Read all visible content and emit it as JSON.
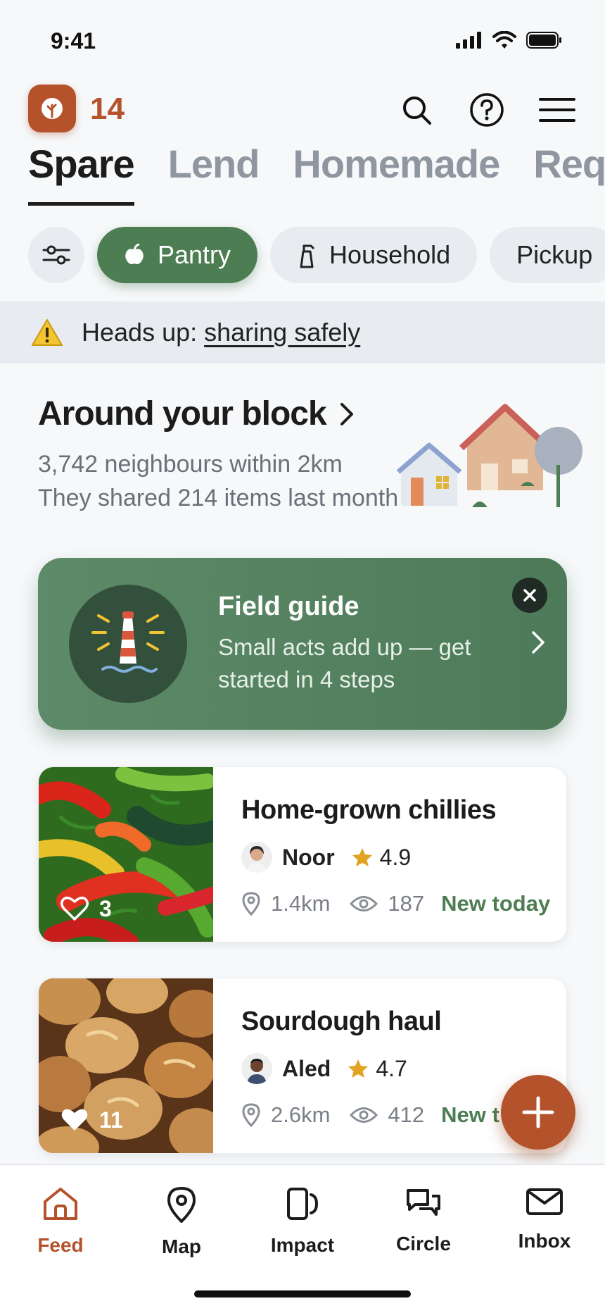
{
  "status": {
    "time": "9:41"
  },
  "header": {
    "badge_count": "14"
  },
  "tabs": [
    {
      "label": "Spare",
      "active": true
    },
    {
      "label": "Lend",
      "active": false
    },
    {
      "label": "Homemade",
      "active": false
    },
    {
      "label": "Req",
      "active": false
    }
  ],
  "chips": [
    {
      "label": "Pantry",
      "icon": "apple-icon",
      "active": true
    },
    {
      "label": "Household",
      "icon": "spray-bottle-icon",
      "active": false
    },
    {
      "label": "Pickup",
      "icon": "",
      "active": false
    }
  ],
  "banner": {
    "prefix": "Heads up:",
    "link": "sharing safely"
  },
  "around": {
    "title": "Around your block",
    "neighbours": "3,742 neighbours within 2km",
    "shared": "They shared 214 items last month"
  },
  "guide": {
    "title": "Field guide",
    "subtitle": "Small acts add up — get started in 4 steps"
  },
  "listings": [
    {
      "title": "Home-grown chillies",
      "owner": "Noor",
      "rating": "4.9",
      "likes": "3",
      "distance": "1.4km",
      "views": "187",
      "freshness": "New today"
    },
    {
      "title": "Sourdough haul",
      "owner": "Aled",
      "rating": "4.7",
      "likes": "11",
      "distance": "2.6km",
      "views": "412",
      "freshness": "New t"
    }
  ],
  "nav": [
    {
      "label": "Feed",
      "active": true
    },
    {
      "label": "Map",
      "active": false
    },
    {
      "label": "Impact",
      "active": false
    },
    {
      "label": "Circle",
      "active": false
    },
    {
      "label": "Inbox",
      "active": false
    }
  ],
  "colors": {
    "accent": "#b4522b",
    "green": "#4d7d52",
    "background": "#f6f8fa"
  }
}
